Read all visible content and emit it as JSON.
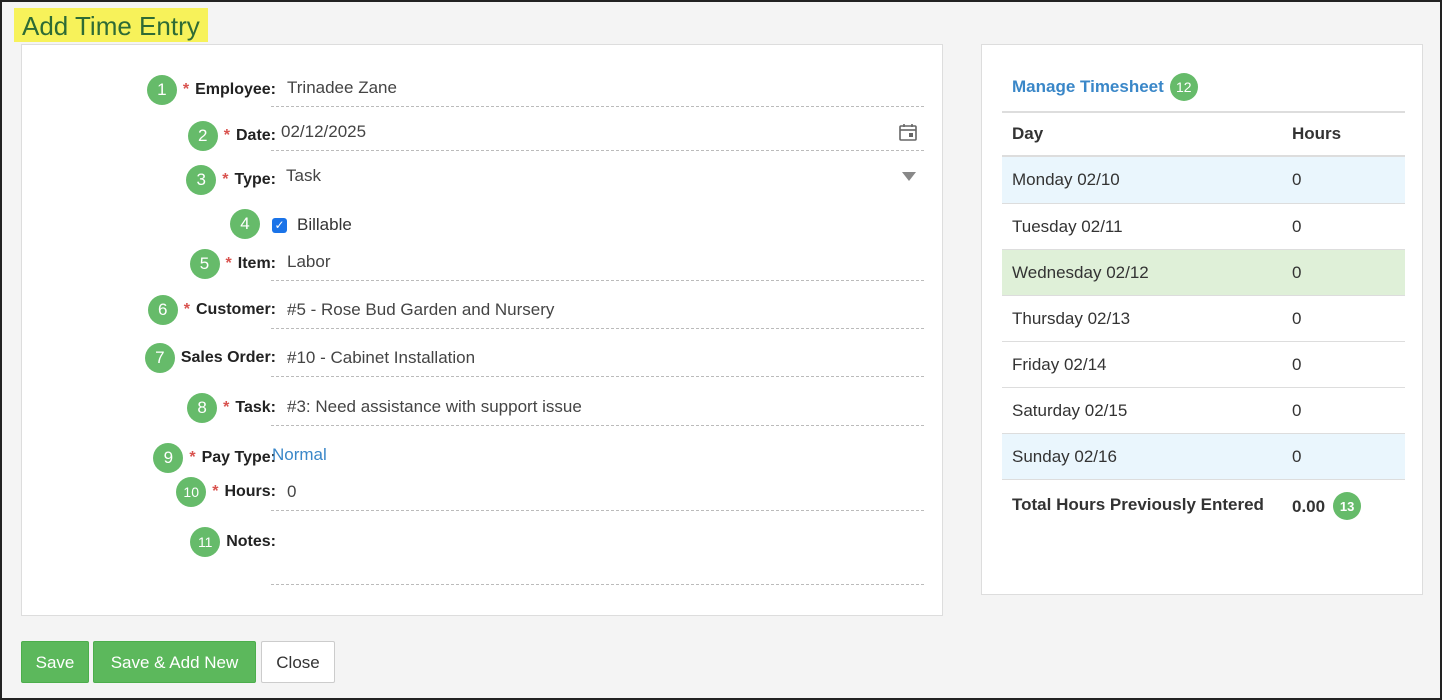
{
  "page_title": "Add Time Entry",
  "form": {
    "employee": {
      "badge": "1",
      "label": "Employee:",
      "value": "Trinadee Zane"
    },
    "date": {
      "badge": "2",
      "label": "Date:",
      "value": "02/12/2025"
    },
    "type": {
      "badge": "3",
      "label": "Type:",
      "value": "Task"
    },
    "billable": {
      "badge": "4",
      "label": "Billable",
      "checked": true
    },
    "item": {
      "badge": "5",
      "label": "Item:",
      "value": "Labor"
    },
    "customer": {
      "badge": "6",
      "label": "Customer:",
      "value": "#5 - Rose Bud Garden and Nursery"
    },
    "sales_order": {
      "badge": "7",
      "label": "Sales Order:",
      "value": "#10 - Cabinet Installation"
    },
    "task": {
      "badge": "8",
      "label": "Task:",
      "value": "#3: Need assistance with support issue"
    },
    "pay_type": {
      "badge": "9",
      "label": "Pay Type:",
      "value": "Normal"
    },
    "hours": {
      "badge": "10",
      "label": "Hours:",
      "value": "0"
    },
    "notes": {
      "badge": "11",
      "label": "Notes:",
      "value": ""
    },
    "required_mark": "*"
  },
  "buttons": {
    "save": "Save",
    "save_add_new": "Save & Add New",
    "close": "Close"
  },
  "timesheet": {
    "link": "Manage Timesheet",
    "link_badge": "12",
    "col_day": "Day",
    "col_hours": "Hours",
    "rows": [
      {
        "day": "Monday 02/10",
        "hours": "0"
      },
      {
        "day": "Tuesday 02/11",
        "hours": "0"
      },
      {
        "day": "Wednesday 02/12",
        "hours": "0"
      },
      {
        "day": "Thursday 02/13",
        "hours": "0"
      },
      {
        "day": "Friday 02/14",
        "hours": "0"
      },
      {
        "day": "Saturday 02/15",
        "hours": "0"
      },
      {
        "day": "Sunday 02/16",
        "hours": "0"
      }
    ],
    "total_label": "Total Hours Previously Entered",
    "total_value": "0.00",
    "total_badge": "13"
  },
  "colors": {
    "accent_green": "#5cb85c",
    "link_blue": "#3a87c8",
    "highlight_yellow": "#f7f25a",
    "required_red": "#d9534f"
  }
}
